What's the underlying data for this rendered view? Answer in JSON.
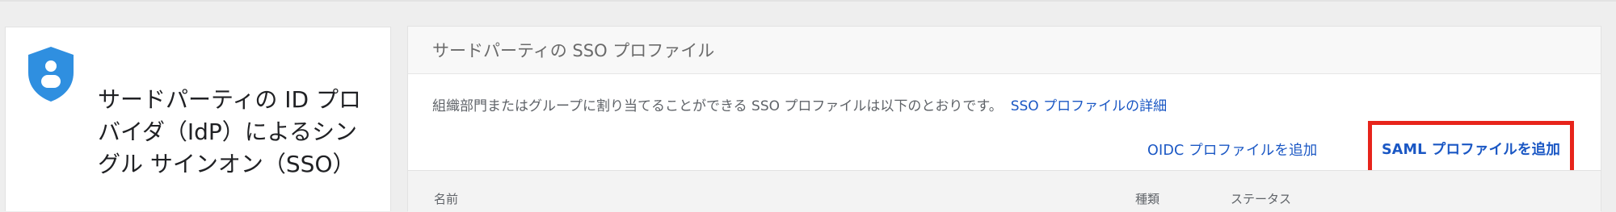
{
  "left_card": {
    "title": "サードパーティの ID プロバイダ（IdP）によるシングル サインオン（SSO）",
    "icon": "shield-user-icon"
  },
  "panel": {
    "title": "サードパーティの SSO プロファイル",
    "description": "組織部門またはグループに割り当てることができる SSO プロファイルは以下のとおりです。",
    "details_link": "SSO プロファイルの詳細",
    "actions": {
      "add_oidc": "OIDC プロファイルを追加",
      "add_saml": "SAML プロファイルを追加"
    },
    "table": {
      "columns": [
        "名前",
        "種類",
        "ステータス"
      ]
    }
  },
  "colors": {
    "accent_blue": "#1a57c4",
    "highlight_red": "#e7241b",
    "shield_blue": "#2f8fe0"
  }
}
